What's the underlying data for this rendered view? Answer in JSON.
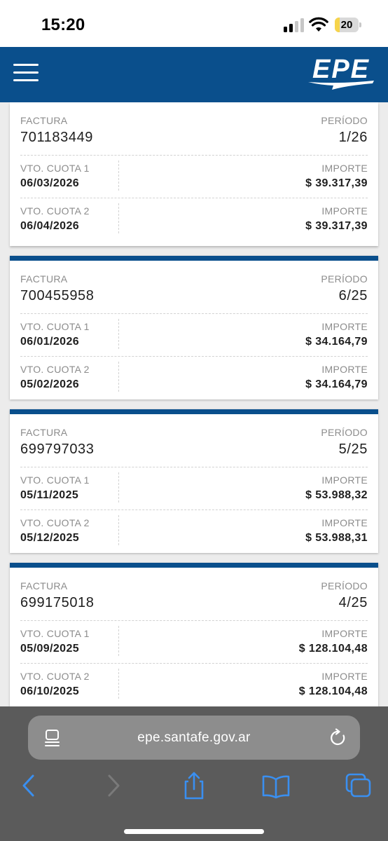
{
  "status": {
    "time": "15:20",
    "battery_pct": "20",
    "battery_level": 0.2
  },
  "app": {
    "logo_text": "EPE",
    "colors": {
      "brand": "#0a4f8c",
      "accent": "#3a8ff0"
    }
  },
  "labels": {
    "factura": "FACTURA",
    "periodo": "PERÍODO",
    "vto1": "VTO. CUOTA 1",
    "vto2": "VTO. CUOTA 2",
    "importe": "IMPORTE"
  },
  "invoices": [
    {
      "factura": "701183449",
      "periodo": "1/26",
      "vto1": "06/03/2026",
      "importe1": "$ 39.317,39",
      "vto2": "06/04/2026",
      "importe2": "$ 39.317,39"
    },
    {
      "factura": "700455958",
      "periodo": "6/25",
      "vto1": "06/01/2026",
      "importe1": "$ 34.164,79",
      "vto2": "05/02/2026",
      "importe2": "$ 34.164,79"
    },
    {
      "factura": "699797033",
      "periodo": "5/25",
      "vto1": "05/11/2025",
      "importe1": "$ 53.988,32",
      "vto2": "05/12/2025",
      "importe2": "$ 53.988,31"
    },
    {
      "factura": "699175018",
      "periodo": "4/25",
      "vto1": "05/09/2025",
      "importe1": "$ 128.104,48",
      "vto2": "06/10/2025",
      "importe2": "$ 128.104,48"
    }
  ],
  "browser": {
    "url": "epe.santafe.gov.ar",
    "icons": [
      "reader-icon",
      "reload-icon",
      "back-icon",
      "forward-icon",
      "share-icon",
      "bookmarks-icon",
      "tabs-icon"
    ]
  }
}
